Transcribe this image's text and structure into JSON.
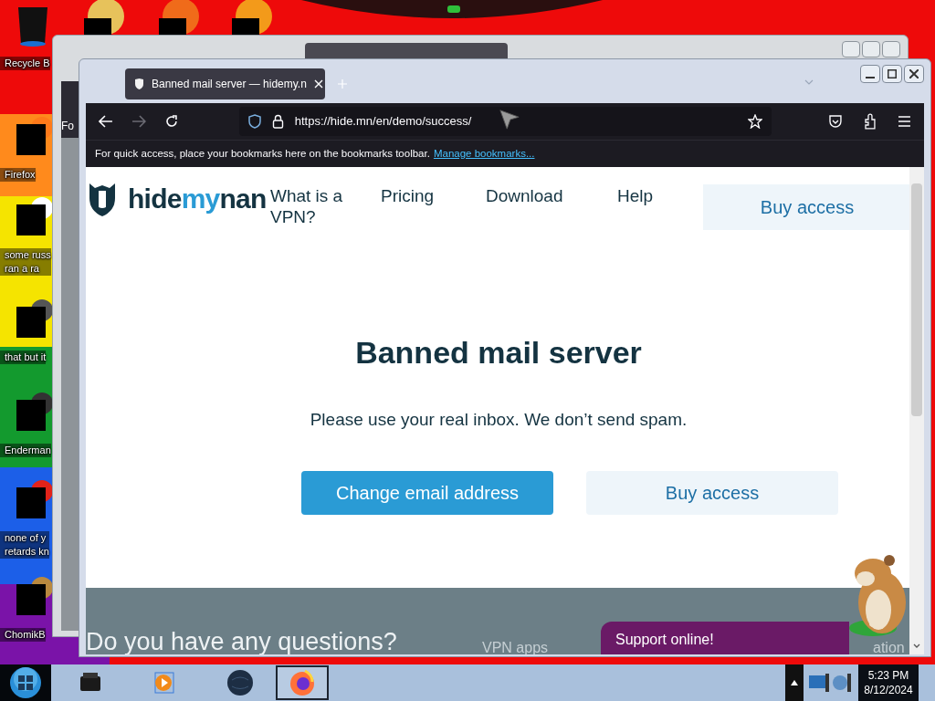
{
  "desktop": {
    "icons": [
      {
        "kind": "bin",
        "label_lines": [
          "Recycle B"
        ]
      },
      {
        "kind": "firefox",
        "label_lines": [
          "Firefox"
        ]
      },
      {
        "label_lines": [
          "some russ",
          "ran a ra"
        ]
      },
      {
        "kind": "stack",
        "label_lines": [
          "that but it"
        ]
      },
      {
        "kind": "terminal",
        "label_lines": [
          "Enderman"
        ]
      },
      {
        "kind": "browser",
        "label_lines": [
          "none of y",
          "retards kn"
        ]
      },
      {
        "kind": "hamster",
        "label_lines": [
          "ChomikB"
        ]
      }
    ]
  },
  "back_window": {
    "text_fragment": "Fo"
  },
  "browser": {
    "tab": {
      "title": "Banned mail server — hidemy.n",
      "selected": true
    },
    "url": "https://hide.mn/en/demo/success/",
    "bookmarks_hint": "For quick access, place your bookmarks here on the bookmarks toolbar.",
    "bookmarks_link": "Manage bookmarks..."
  },
  "page": {
    "logo": [
      "hide",
      "my",
      "nan"
    ],
    "nav": [
      "What is a VPN?",
      "Pricing",
      "Download",
      "Help"
    ],
    "header_button": "Buy access",
    "heading": "Banned mail server",
    "message": "Please use your real inbox. We don’t send spam.",
    "buttons": [
      {
        "label": "Change email address",
        "kind": "primary"
      },
      {
        "label": "Buy access",
        "kind": "secondary"
      }
    ],
    "footer": {
      "heading": "Do you have any questions?",
      "column_1": "VPN apps",
      "column_2": "ation"
    },
    "chat": {
      "label": "Support online!"
    }
  },
  "taskbar": {
    "apps": [
      {
        "kind": "printer",
        "selected": false
      },
      {
        "kind": "player",
        "selected": false
      },
      {
        "kind": "globe",
        "selected": false
      },
      {
        "kind": "firefox",
        "selected": true
      }
    ],
    "clock_time": "5:23 PM",
    "clock_date": "8/12/2024"
  }
}
